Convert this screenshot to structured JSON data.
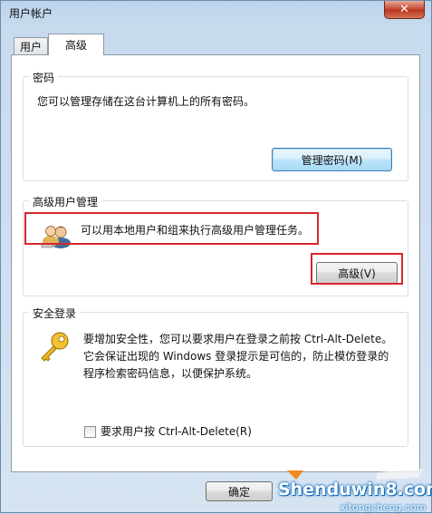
{
  "window": {
    "title": "用户帐户",
    "close_glyph": "✕"
  },
  "tabs": [
    {
      "label": "用户",
      "active": false
    },
    {
      "label": "高级",
      "active": true
    }
  ],
  "password_group": {
    "legend": "密码",
    "description": "您可以管理存储在这台计算机上的所有密码。",
    "button_label": "管理密码(M)"
  },
  "advanced_group": {
    "legend": "高级用户管理",
    "description": "可以用本地用户和组来执行高级用户管理任务。",
    "button_label": "高级(V)",
    "icon": "users-icon"
  },
  "secure_logon_group": {
    "legend": "安全登录",
    "description_line1": "要增加安全性，您可以要求用户在登录之前按 Ctrl-Alt-Delete。",
    "description_line2": "它会保证出现的 Windows 登录提示是可信的，防止模仿登录的",
    "description_line3": "程序检索密码信息，以便保护系统。",
    "icon": "key-icon",
    "checkbox_label": "要求用户按 Ctrl-Alt-Delete(R)",
    "checkbox_checked": false
  },
  "footer": {
    "ok_label": "确定"
  },
  "watermark": {
    "main": "Shenduwin8.com",
    "sub": "xitongcheng.com"
  },
  "colors": {
    "highlight_box": "#d8262b",
    "focus_border": "#3c7fb1"
  }
}
